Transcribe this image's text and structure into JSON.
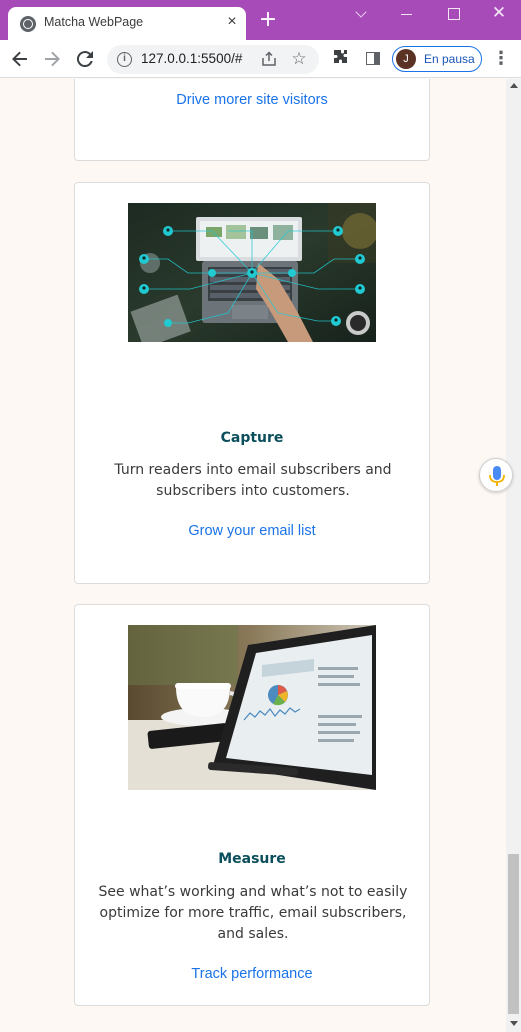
{
  "browser": {
    "tab_title": "Matcha WebPage",
    "tab_close": "×",
    "new_tab": "+",
    "url": "127.0.0.1:5500/#",
    "profile_initial": "J",
    "profile_label": "En pausa"
  },
  "cards": [
    {
      "link": "Drive morer site visitors"
    },
    {
      "title": "Capture",
      "text": "Turn readers into email subscribers and subscribers into customers.",
      "link": "Grow your email list",
      "image": "laptop-network-photo"
    },
    {
      "title": "Measure",
      "text": "See what’s working and what’s not to easily optimize for more traffic, email subscribers, and sales.",
      "link": "Track performance",
      "image": "tablet-analytics-photo"
    }
  ],
  "colors": {
    "tab_bar": "#a64bb8",
    "page_bg": "#fdf8f3",
    "title": "#0b4f5c",
    "link": "#1a73e8"
  },
  "icons": [
    "globe-icon",
    "close-icon",
    "plus-icon",
    "back-icon",
    "forward-icon",
    "reload-icon",
    "info-icon",
    "share-icon",
    "star-icon",
    "extensions-icon",
    "side-panel-icon",
    "menu-icon",
    "mic-icon"
  ]
}
